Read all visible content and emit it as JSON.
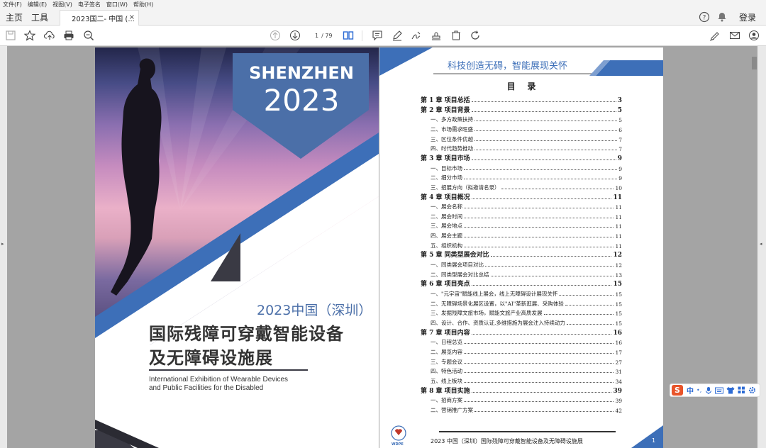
{
  "menu": [
    "文件(F)",
    "编辑(E)",
    "视图(V)",
    "电子签名",
    "窗口(W)",
    "帮助(H)"
  ],
  "tabs": {
    "home": "主页",
    "tools": "工具",
    "doc": "2023国二- 中国 (...",
    "close": "×"
  },
  "login": "登录",
  "page_nav": {
    "current": "1",
    "total": "/ 79"
  },
  "cover": {
    "city": "SHENZHEN",
    "year": "2023",
    "subtitle": "2023中国（深圳）",
    "title_line1": "国际残障可穿戴智能设备",
    "title_line2": "及无障碍设施展",
    "en_line1": "International Exhibition of Wearable Devices",
    "en_line2": "and Public Facilities for the Disabled"
  },
  "toc": {
    "slogan": "科技创造无碍，智能展现关怀",
    "heading": "目    录",
    "items": [
      {
        "type": "ch",
        "text": "第 1 章  项目总括",
        "page": "3"
      },
      {
        "type": "ch",
        "text": "第 2 章  项目背景",
        "page": "5"
      },
      {
        "type": "sub",
        "text": "一、多方政策扶持",
        "page": "5"
      },
      {
        "type": "sub",
        "text": "二、市场需求旺盛",
        "page": "6"
      },
      {
        "type": "sub",
        "text": "三、区位条件优越",
        "page": "7"
      },
      {
        "type": "sub",
        "text": "四、时代趋势推动",
        "page": "7"
      },
      {
        "type": "ch",
        "text": "第 3 章  项目市场",
        "page": "9"
      },
      {
        "type": "sub",
        "text": "一、目标市场",
        "page": "9"
      },
      {
        "type": "sub",
        "text": "二、细分市场",
        "page": "9"
      },
      {
        "type": "sub",
        "text": "三、招展方向（拟邀请名录）",
        "page": "10"
      },
      {
        "type": "ch",
        "text": "第 4 章  项目概况",
        "page": "11"
      },
      {
        "type": "sub",
        "text": "一、展会名称",
        "page": "11"
      },
      {
        "type": "sub",
        "text": "二、展会时间",
        "page": "11"
      },
      {
        "type": "sub",
        "text": "三、展会地点",
        "page": "11"
      },
      {
        "type": "sub",
        "text": "四、展会主题",
        "page": "11"
      },
      {
        "type": "sub",
        "text": "五、组织机构",
        "page": "11"
      },
      {
        "type": "ch",
        "text": "第 5 章  同类型展会对比",
        "page": "12"
      },
      {
        "type": "sub",
        "text": "一、同类展会项目对比",
        "page": "12"
      },
      {
        "type": "sub",
        "text": "二、同类型展会对比总结",
        "page": "13"
      },
      {
        "type": "ch",
        "text": "第 6 章  项目亮点",
        "page": "15"
      },
      {
        "type": "sub",
        "text": "一、\"元宇宙\"赋能线上展会，线上无障碍设计展现关怀",
        "page": "15"
      },
      {
        "type": "sub",
        "text": "二、无障碍场景化展区设置，以\"AI\"革新逛展、采购体验",
        "page": "15"
      },
      {
        "type": "sub",
        "text": "三、发掘残障文旅市场，赋能文旅产业高质发展",
        "page": "15"
      },
      {
        "type": "sub",
        "text": "四、设计、合作、资质认证,多维措施为展会注入持续动力",
        "page": "15"
      },
      {
        "type": "ch",
        "text": "第 7 章  项目内容",
        "page": "16"
      },
      {
        "type": "sub",
        "text": "一、日程总览",
        "page": "16"
      },
      {
        "type": "sub",
        "text": "二、展览内容",
        "page": "17"
      },
      {
        "type": "sub",
        "text": "三、专题会议",
        "page": "27"
      },
      {
        "type": "sub",
        "text": "四、特色活动",
        "page": "31"
      },
      {
        "type": "sub",
        "text": "五、线上板块",
        "page": "34"
      },
      {
        "type": "ch",
        "text": "第 8 章  项目实施",
        "page": "39"
      },
      {
        "type": "sub",
        "text": "一、招商方案",
        "page": "39"
      },
      {
        "type": "sub",
        "text": "二、营销推广方案",
        "page": "42"
      }
    ],
    "footer": "2023 中国（深圳）国际残障可穿戴智能设备及无障碍设施展",
    "page_no": "1",
    "logo_text": "WDPE"
  },
  "ime": {
    "logo": "S",
    "lang": "中",
    "punct": "•,"
  },
  "colors": {
    "accent": "#3d6fb8",
    "dark": "#333333",
    "toolbar_blue": "#2d6bd4"
  }
}
